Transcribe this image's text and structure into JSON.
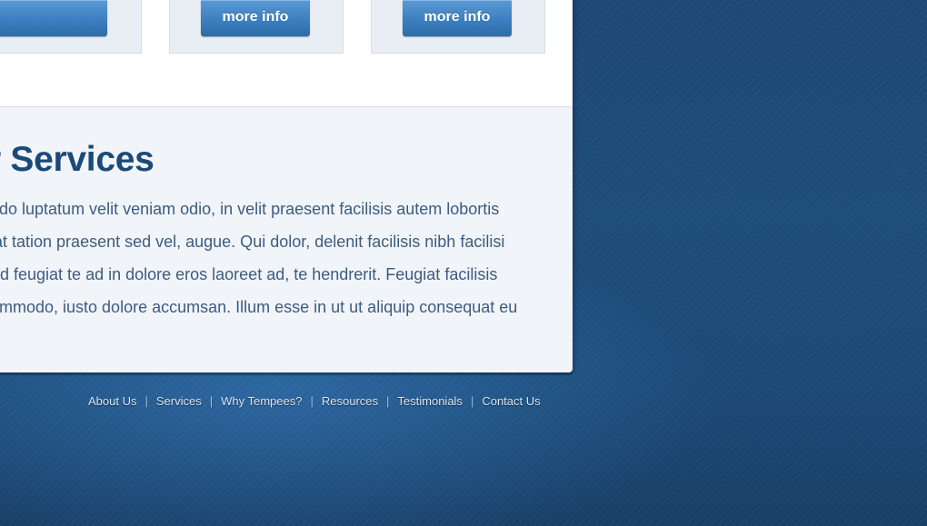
{
  "features": {
    "buttons": [
      {
        "label": ""
      },
      {
        "label": "more info"
      },
      {
        "label": "more info"
      }
    ]
  },
  "services": {
    "title": "r Services",
    "lines": [
      "do luptatum velit veniam odio, in velit praesent facilisis autem lobortis",
      "at tation praesent sed vel, augue. Qui dolor, delenit facilisis nibh facilisi",
      "d feugiat te ad in dolore eros laoreet ad, te hendrerit. Feugiat facilisis",
      "mmodo, iusto dolore accumsan. Illum esse in ut ut aliquip consequat eu"
    ]
  },
  "footer": {
    "links": [
      "About Us",
      "Services",
      "Why Tempees?",
      "Resources",
      "Testimonials",
      "Contact Us"
    ],
    "separator": "|"
  },
  "colors": {
    "page_background": "#1c4d7b",
    "title": "#1c4a78",
    "button": "#3c7fc0"
  }
}
